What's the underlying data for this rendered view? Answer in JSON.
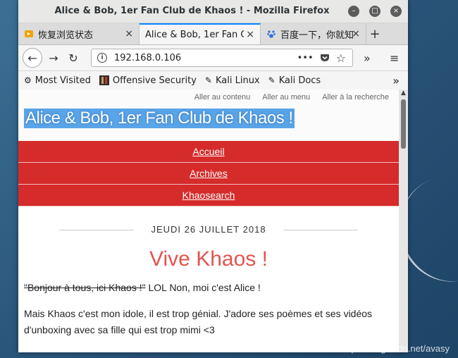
{
  "window": {
    "title": "Alice & Bob, 1er Fan Club de Khaos ! - Mozilla Firefox"
  },
  "tabs": [
    {
      "label": "恢复浏览状态",
      "close": "×"
    },
    {
      "label": "Alice & Bob, 1er Fan C",
      "close": "×"
    },
    {
      "label": "百度一下，你就知",
      "close": "×"
    }
  ],
  "newtab": "+",
  "nav": {
    "url": "192.168.0.106",
    "more": "•••",
    "overflow": "»",
    "menu": "≡"
  },
  "bookmarks": [
    {
      "label": "Most Visited"
    },
    {
      "label": "Offensive Security"
    },
    {
      "label": "Kali Linux"
    },
    {
      "label": "Kali Docs"
    }
  ],
  "bookmarks_overflow": "»",
  "page": {
    "skip_links": [
      "Aller au contenu",
      "Aller au menu",
      "Aller à la recherche"
    ],
    "site_title": "Alice & Bob, 1er Fan Club de Khaos !",
    "menu": [
      "Accueil",
      "Archives",
      "Khaosearch"
    ],
    "post_date": "JEUDI 26 JUILLET 2018",
    "post_title": "Vive Khaos !",
    "para1_strike": "\"Bonjour à tous, ici Khaos !\"",
    "para1_rest": " LOL Non, moi c'est Alice !",
    "para2": "Mais Khaos c'est mon idole, il est trop génial. J'adore ses poèmes et ses vidéos d'unboxing avec sa fille qui est trop mimi <3"
  },
  "watermark": "https://blog.csdn.net/avasy"
}
